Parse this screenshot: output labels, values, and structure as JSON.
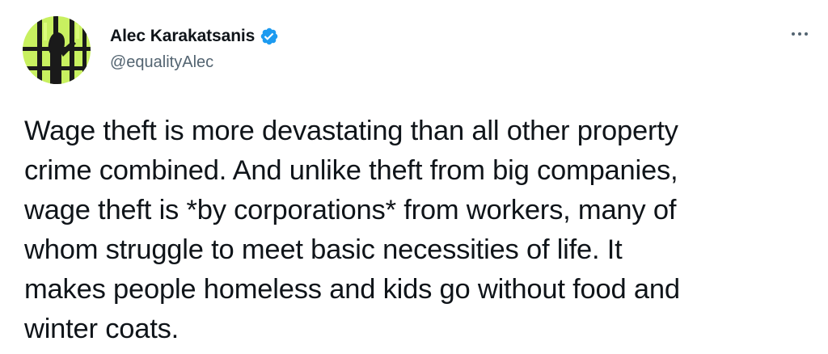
{
  "tweet": {
    "author": {
      "display_name": "Alec Karakatsanis",
      "handle": "@equalityAlec",
      "verified": true,
      "avatar_icon": "barred-window-avatar-icon"
    },
    "more_icon": "more-horizontal-icon",
    "text": "Wage theft is more devastating than all other property\ncrime combined. And unlike theft from big companies,\nwage theft is *by corporations* from workers, many of\nwhom struggle to meet basic necessities of life. It\nmakes people homeless and kids go without food and\nwinter coats."
  },
  "colors": {
    "verified_badge": "#1d9bf0",
    "text_primary": "#0f1419",
    "text_secondary": "#536471",
    "avatar_bg": "#c8f060"
  }
}
